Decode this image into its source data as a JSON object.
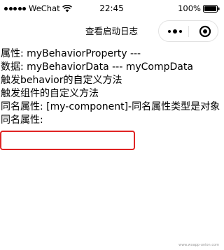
{
  "status_bar": {
    "carrier": "WeChat",
    "time": "22:45",
    "battery": "100%"
  },
  "nav_bar": {
    "title": "查看启动日志"
  },
  "content": {
    "lines": [
      "属性: myBehaviorProperty ---",
      "数据: myBehaviorData --- myCompData",
      "触发behavior的自定义方法",
      "触发组件的自定义方法",
      "同名属性: [my-component]-同名属性类型是对象",
      "同名属性:"
    ]
  },
  "watermark": "www.wxapp-union.com",
  "colors": {
    "highlight_border": "#e02424",
    "capsule_border": "#e2e2e2"
  }
}
